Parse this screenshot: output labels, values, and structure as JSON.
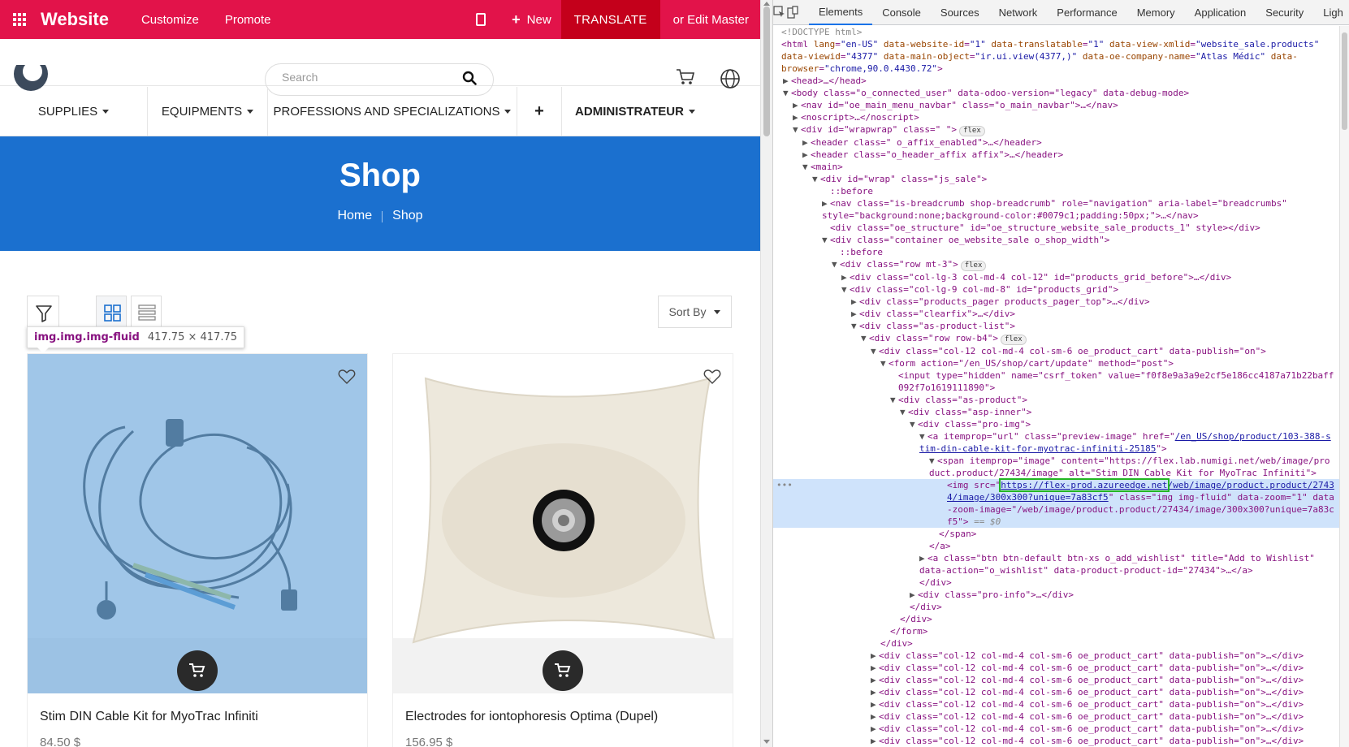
{
  "editbar": {
    "brand": "Website",
    "customize": "Customize",
    "promote": "Promote",
    "new": "New",
    "translate": "TRANSLATE",
    "edit_master": "or Edit Master",
    "accent_color": "#e2134a"
  },
  "header": {
    "search_placeholder": "Search"
  },
  "menu": {
    "items": [
      "SUPPLIES",
      "EQUIPMENTS",
      "PROFESSIONS AND SPECIALIZATIONS",
      "+",
      "ADMINISTRATEUR"
    ]
  },
  "banner": {
    "title": "Shop",
    "breadcrumb": [
      "Home",
      "Shop"
    ],
    "color": "#1b70cf"
  },
  "toolbar": {
    "sort": "Sort By"
  },
  "tooltip": {
    "selector": "img.img.img-fluid",
    "size": "417.75 × 417.75"
  },
  "products": [
    {
      "name": "Stim DIN Cable Kit for MyoTrac Infiniti",
      "price": "84.50 $"
    },
    {
      "name": "Electrodes for iontophoresis Optima (Dupel)",
      "price": "156.95 $"
    }
  ],
  "devtools": {
    "tabs": [
      "Elements",
      "Console",
      "Sources",
      "Network",
      "Performance",
      "Memory",
      "Application",
      "Security",
      "Ligh"
    ],
    "active_tab": "Elements",
    "dom": {
      "doctype": "<!DOCTYPE html>",
      "html_tag": "html",
      "html_attrs": [
        [
          "lang",
          "en-US"
        ],
        [
          "data-website-id",
          "1"
        ],
        [
          "data-translatable",
          "1"
        ],
        [
          "data-view-xmlid",
          "website_sale.products"
        ],
        [
          "data-viewid",
          "4377"
        ],
        [
          "data-main-object",
          "ir.ui.view(4377,)"
        ],
        [
          "data-oe-company-name",
          "Atlas Médic"
        ],
        [
          "data-browser",
          "chrome,90.0.4430.72"
        ]
      ],
      "head": "<head>…</head>",
      "body_line": "body class=\"o_connected_user\" data-odoo-version=\"legacy\" data-debug-mode",
      "nav_line": "nav id=\"oe_main_menu_navbar\" class=\"o_main_navbar\">…</nav>",
      "noscript_line": "noscript>…</noscript>",
      "wrapwrap_line": "div id=\"wrapwrap\" class=\"   \">",
      "flex_badge": "flex",
      "header1_line": "header class=\" o_affix_enabled\">…</header>",
      "header2_line": "header class=\"o_header_affix affix\">…</header>",
      "main_line": "main>",
      "wrap_line": "div id=\"wrap\" class=\"js_sale\">",
      "before": "::before",
      "nav_bc_line": "nav class=\"is-breadcrumb shop-breadcrumb\" role=\"navigation\" aria-label=\"breadcrumbs\" style=\"background:none;background-color:#0079c1;padding:50px;\">…</nav>",
      "structure_line": "div class=\"oe_structure\" id=\"oe_structure_website_sale_products_1\" style></div>",
      "container_line": "div class=\"container oe_website_sale o_shop_width\">",
      "row_line": "div class=\"row mt-3\">",
      "col_line": "div class=\"col-lg-3 col-md-4 col-12\" id=\"products_grid_before\">…</div>",
      "grid_line": "div class=\"col-lg-9 col-md-8\" id=\"products_grid\">",
      "pager_line": "div class=\"products_pager products_pager_top\">…</div>",
      "clearfix_line": "div class=\"clearfix\">…</div>",
      "aslist_line": "div class=\"as-product-list\">",
      "rowb4_line": "div class=\"row row-b4\">",
      "cart_line": "div class=\"col-12 col-md-4 col-sm-6 oe_product_cart\" data-publish=\"on\">",
      "form_line": "form action=\"/en_US/shop/cart/update\" method=\"post\">",
      "input_line": "input type=\"hidden\" name=\"csrf_token\" value=\"f0f8e9a3a9e2cf5e186cc4187a71b22baff092f7o1619111890\">",
      "asproduct_line": "div class=\"as-product\">",
      "aspinner_line": "div class=\"asp-inner\">",
      "proimg_line": "div class=\"pro-img\">",
      "a_line_1": "a itemprop=\"url\" class=\"preview-image\" href=\"",
      "a_href": "/en_US/shop/product/103-388-stim-din-cable-kit-for-myotrac-infiniti-25185",
      "a_line_2": "\">",
      "span_line": "span itemprop=\"image\" content=\"https://flex.lab.numigi.net/web/image/product.product/27434/image\" alt=\"Stim DIN Cable Kit for MyoTrac Infiniti\">",
      "img_src_host": "https://flex-prod.azureedge.net",
      "img_src_path": "/web/image/product.product/27434/image/300x300?unique=7a83cf5",
      "img_rest": "\" class=\"img img-fluid\" data-zoom=\"1\" data-zoom-image=\"/web/image/product.product/27434/image/300x300?unique=7a83cf5\">",
      "eq": "== $0",
      "span_close": "</span>",
      "a_close": "</a>",
      "wish_line": "a class=\"btn btn-default btn-xs o_add_wishlist\" title=\"Add to Wishlist\" data-action=\"o_wishlist\" data-product-product-id=\"27434\">…</a>",
      "div_close": "</div>",
      "proinfo_line": "div class=\"pro-info\">…</div>",
      "form_close": "</form>",
      "cart_collapsed": "div class=\"col-12 col-md-4 col-sm-6 oe_product_cart\" data-publish=\"on\">…</div>"
    }
  }
}
